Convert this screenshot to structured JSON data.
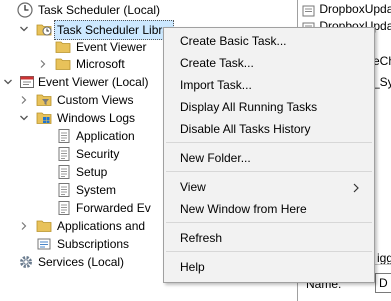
{
  "tree": {
    "task_scheduler_local": "Task Scheduler (Local)",
    "task_scheduler_library": "Task Scheduler Library",
    "event_viewer_folder": "Event Viewer",
    "microsoft_folder": "Microsoft",
    "event_viewer_local": "Event Viewer (Local)",
    "custom_views": "Custom Views",
    "windows_logs": "Windows Logs",
    "application": "Application",
    "security": "Security",
    "setup": "Setup",
    "system": "System",
    "forwarded_events": "Forwarded Ev",
    "applications_and_services": "Applications and",
    "subscriptions": "Subscriptions",
    "services_local": "Services (Local)"
  },
  "right_pane": {
    "row1": "DropboxUpdat",
    "row2": "DropboxUpdat",
    "row3": "eChe",
    "row4": "_Sym",
    "row5": "igge",
    "name_label": "Name:",
    "name_value": "D"
  },
  "context_menu": {
    "create_basic_task": "Create Basic Task...",
    "create_task": "Create Task...",
    "import_task": "Import Task...",
    "display_all_running": "Display All Running Tasks",
    "disable_history": "Disable All Tasks History",
    "new_folder": "New Folder...",
    "view": "View",
    "new_window": "New Window from Here",
    "refresh": "Refresh",
    "help": "Help"
  },
  "colors": {
    "selection_bg": "#cce8ff",
    "menu_bg": "#f2f2f2",
    "folder": "#e8c25a"
  }
}
